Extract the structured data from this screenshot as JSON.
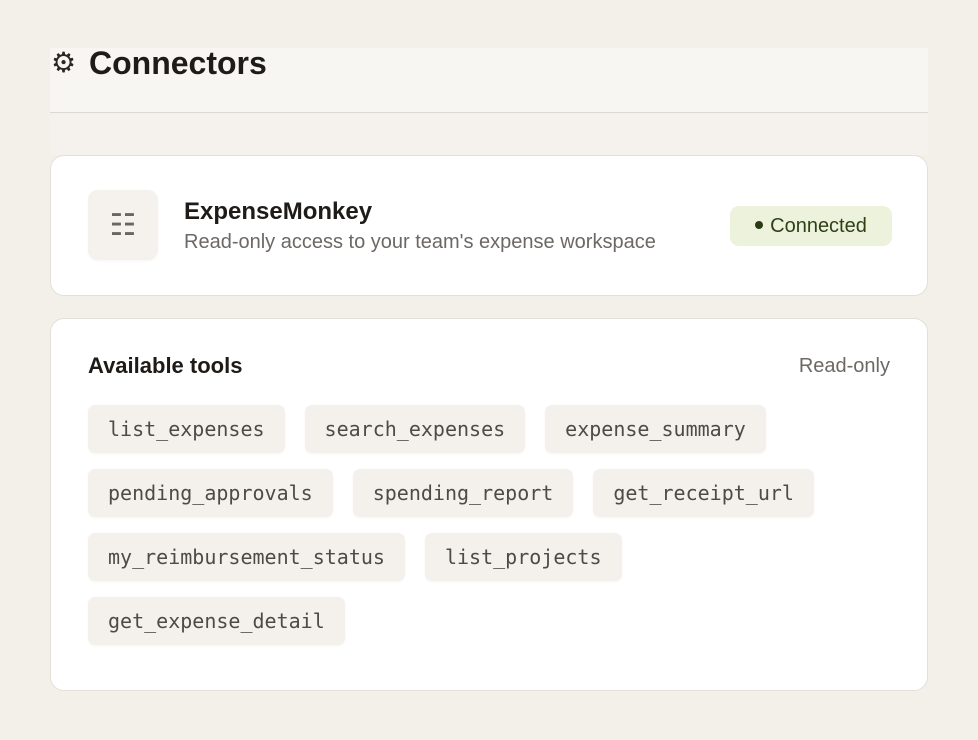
{
  "header": {
    "icon": "gear-icon",
    "title": "Connectors"
  },
  "connector": {
    "icon": "list-icon",
    "name": "ExpenseMonkey",
    "description": "Read-only access to your team's expense workspace",
    "status": "Connected"
  },
  "tools": {
    "title": "Available tools",
    "access": "Read-only",
    "items": [
      "list_expenses",
      "search_expenses",
      "expense_summary",
      "pending_approvals",
      "spending_report",
      "get_receipt_url",
      "my_reimbursement_status",
      "list_projects",
      "get_expense_detail"
    ]
  },
  "colors": {
    "page_background": "#f3efe9",
    "card_background": "#ffffff",
    "status_background": "#edf2dd",
    "status_text": "#2f4017"
  }
}
